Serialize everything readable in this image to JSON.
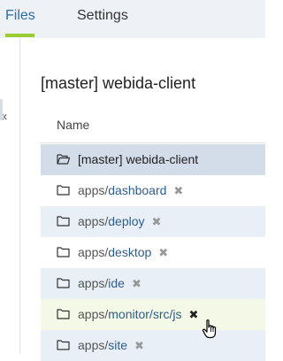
{
  "tabs": [
    {
      "label": "Files",
      "active": true
    },
    {
      "label": "Settings",
      "active": false
    }
  ],
  "sidebar": {
    "collapse_glyph": "«"
  },
  "header": {
    "title": "[master] webida-client"
  },
  "table": {
    "column_name": "Name"
  },
  "root_row": {
    "label": "[master] webida-client",
    "icon": "open-folder-icon"
  },
  "rows": [
    {
      "prefix": "apps/",
      "name": "dashboard",
      "remove": "✖"
    },
    {
      "prefix": "apps/",
      "name": "deploy",
      "remove": "✖"
    },
    {
      "prefix": "apps/",
      "name": "desktop",
      "remove": "✖"
    },
    {
      "prefix": "apps/",
      "name": "ide",
      "remove": "✖"
    },
    {
      "prefix": "apps/",
      "name": "monitor/src/js",
      "remove": "✖",
      "hovered": true
    },
    {
      "prefix": "apps/",
      "name": "site",
      "remove": "✖"
    }
  ],
  "colors": {
    "accent_underline": "#9acd32",
    "active_tab": "#2f6ea3",
    "selected_row": "#d3dde9",
    "stripe_row": "#e9eff6",
    "hover_row": "#f3f9e6",
    "project_link": "#2f5d8a"
  }
}
